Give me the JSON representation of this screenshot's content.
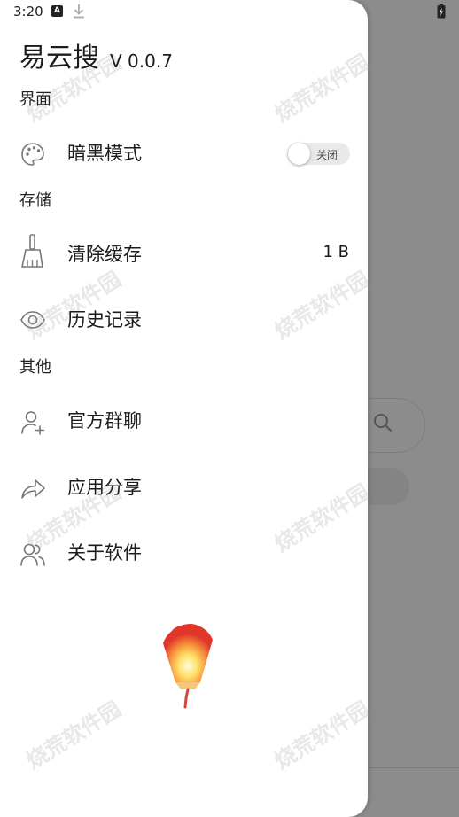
{
  "status_bar": {
    "time": "3:20",
    "icons": [
      "keyboard-icon",
      "download-icon",
      "battery-charging-icon"
    ]
  },
  "drawer": {
    "title": "易云搜",
    "version": "V 0.0.7",
    "sections": [
      {
        "header": "界面",
        "items": [
          {
            "label": "暗黑模式",
            "icon": "palette-icon",
            "toggle": {
              "label": "关闭",
              "state": "off"
            }
          }
        ]
      },
      {
        "header": "存储",
        "items": [
          {
            "label": "清除缓存",
            "icon": "broom-icon",
            "value": "1 B"
          },
          {
            "label": "历史记录",
            "icon": "eye-icon"
          }
        ]
      },
      {
        "header": "其他",
        "items": [
          {
            "label": "官方群聊",
            "icon": "add-user-icon"
          },
          {
            "label": "应用分享",
            "icon": "share-icon"
          },
          {
            "label": "关于软件",
            "icon": "users-icon"
          }
        ]
      }
    ]
  },
  "watermark": "烧荒软件园",
  "background_app": {
    "icons": [
      "search-icon"
    ]
  },
  "colors": {
    "scrim": "#8c8c8c",
    "drawer_bg": "#ffffff",
    "text": "#1c1c1c",
    "toggle_track": "#e9e9e9"
  }
}
